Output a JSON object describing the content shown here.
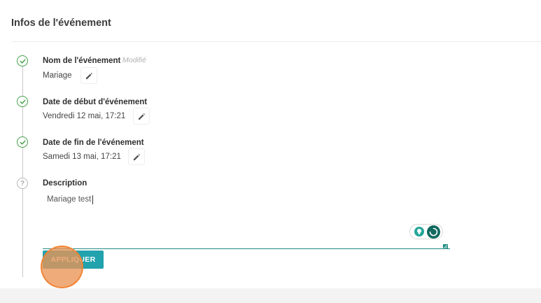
{
  "section": {
    "title": "Infos de l'événement"
  },
  "steps": [
    {
      "label": "Nom de l'événement",
      "value": "Mariage",
      "status": "done",
      "icon": "check-circle-icon",
      "tag": "Modifié"
    },
    {
      "label": "Date de début d'événement",
      "value": "Vendredi 12 mai, 17:21",
      "status": "done",
      "icon": "check-circle-icon"
    },
    {
      "label": "Date de fin de l'événement",
      "value": "Samedi 13 mai, 17:21",
      "status": "done",
      "icon": "check-circle-icon"
    },
    {
      "label": "Description",
      "status": "pending",
      "icon": "question-circle-icon",
      "pending_glyph": "?"
    }
  ],
  "description": {
    "value": "Mariage test"
  },
  "actions": {
    "apply_label": "APPLIQUER"
  },
  "icons": {
    "edit": "pencil-icon",
    "grammar": "lightbulb-icon",
    "resize": "resize-handle-icon"
  },
  "colors": {
    "success": "#43a047",
    "accent": "#22a2ad",
    "input_underline": "#208a83",
    "click_marker": "#f28232"
  }
}
